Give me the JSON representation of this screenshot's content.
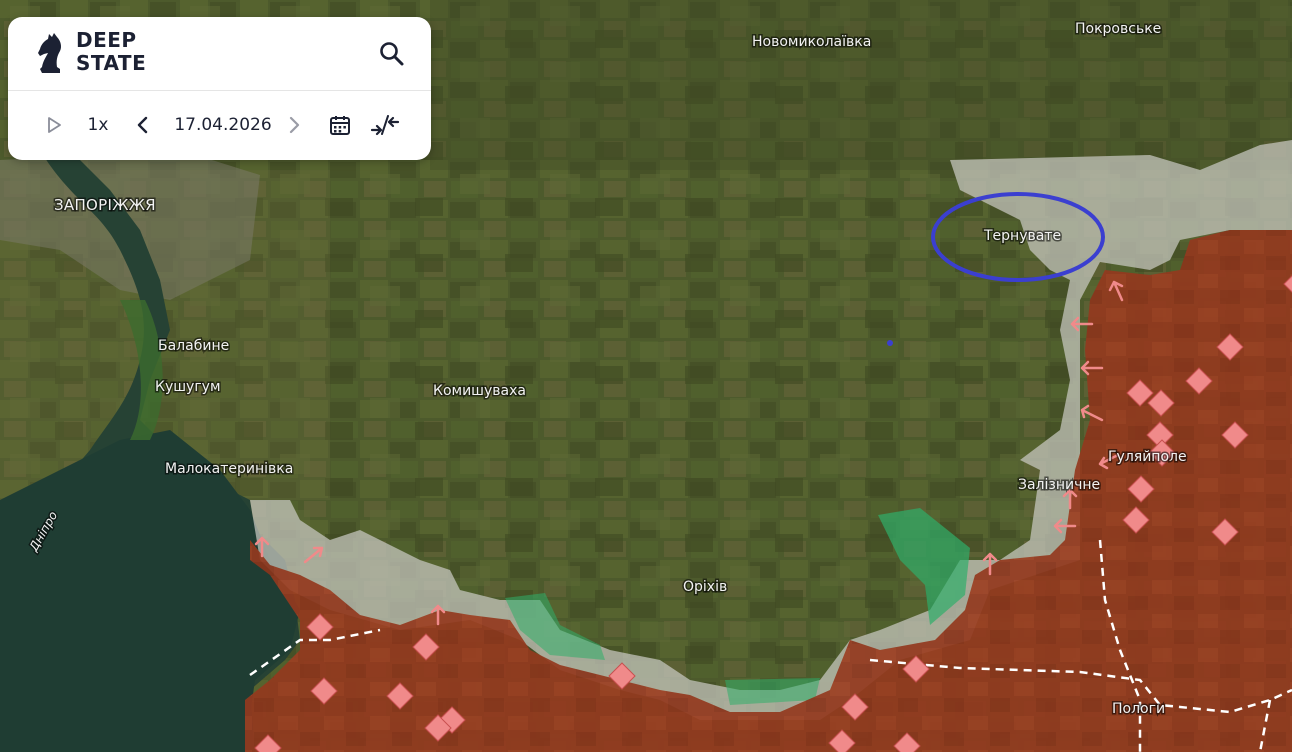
{
  "app": {
    "brand_line1": "DEEP",
    "brand_line2": "STATE",
    "logo_icon": "knight-chess-piece-icon",
    "search_icon": "search-icon"
  },
  "controls": {
    "play_icon": "play-icon",
    "speed": "1x",
    "prev_icon": "chevron-left-icon",
    "date": "17.04.2026",
    "next_icon": "chevron-right-icon",
    "calendar_icon": "calendar-icon",
    "compare_icon": "collapse-arrows-icon"
  },
  "map": {
    "places": {
      "novomykolaivka": "Новомиколаївка",
      "pokrovske": "Покровське",
      "zaporizhzhia": "ЗАПОРІЖЖЯ",
      "ternuvate": "Тернувате",
      "balabyne": "Балабине",
      "kushuhum": "Кушугум",
      "komyshuvakha": "Комишуваха",
      "malokaterynivka": "Малокатеринівка",
      "huliaipole": "Гуляйполе",
      "zaliznychne": "Залізничне",
      "orikhiv": "Оріхів",
      "polohy": "Пологи"
    },
    "river": "Дніпро",
    "colors": {
      "occupied": "#9a3b1f",
      "contested": "#c9c9c2",
      "liberated": "#2fae6a",
      "highlight_ellipse": "#3b3fd0",
      "marker": "#f08a8a"
    }
  }
}
